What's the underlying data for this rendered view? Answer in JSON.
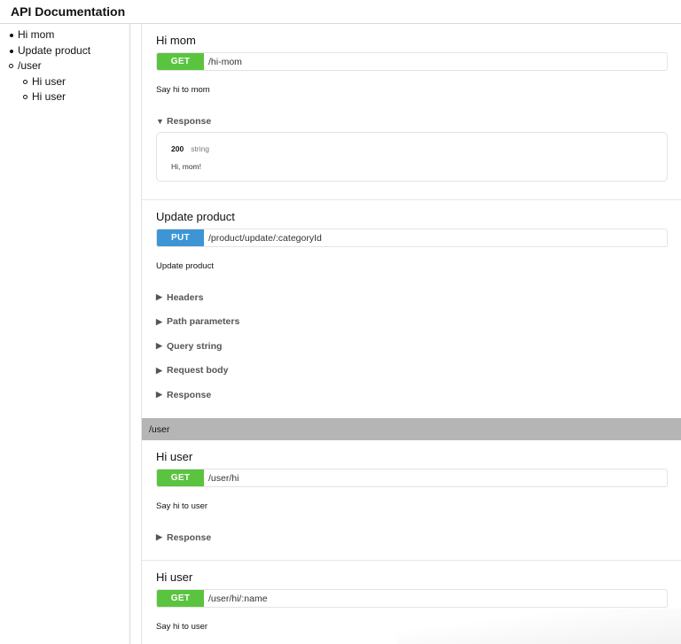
{
  "app": {
    "title": "API Documentation"
  },
  "sidebar": {
    "items": [
      {
        "label": "Hi mom"
      },
      {
        "label": "Update product"
      },
      {
        "label": "/user"
      },
      {
        "label": "Hi user"
      },
      {
        "label": "Hi user"
      }
    ]
  },
  "endpoints": [
    {
      "title": "Hi mom",
      "method": "GET",
      "path": "/hi-mom",
      "description": "Say hi to mom",
      "sections": [
        {
          "label": "Response",
          "expanded": true,
          "response": {
            "status": "200",
            "type": "string",
            "body": "Hi, mom!"
          }
        }
      ]
    },
    {
      "title": "Update product",
      "method": "PUT",
      "path": "/product/update/:categoryId",
      "description": "Update product",
      "sections": [
        {
          "label": "Headers",
          "expanded": false
        },
        {
          "label": "Path parameters",
          "expanded": false
        },
        {
          "label": "Query string",
          "expanded": false
        },
        {
          "label": "Request body",
          "expanded": false
        },
        {
          "label": "Response",
          "expanded": false
        }
      ]
    }
  ],
  "groups": [
    {
      "name": "/user",
      "endpoints": [
        {
          "title": "Hi user",
          "method": "GET",
          "path": "/user/hi",
          "description": "Say hi to user",
          "sections": [
            {
              "label": "Response",
              "expanded": false
            }
          ]
        },
        {
          "title": "Hi user",
          "method": "GET",
          "path": "/user/hi/:name",
          "description": "Say hi to user",
          "sections": []
        }
      ]
    }
  ],
  "colors": {
    "get": "#5bc43f",
    "put": "#3d95d6",
    "group_bar": "#b5b5b5"
  },
  "icons": {
    "expanded": "triangle-down-icon",
    "collapsed": "triangle-right-icon"
  }
}
